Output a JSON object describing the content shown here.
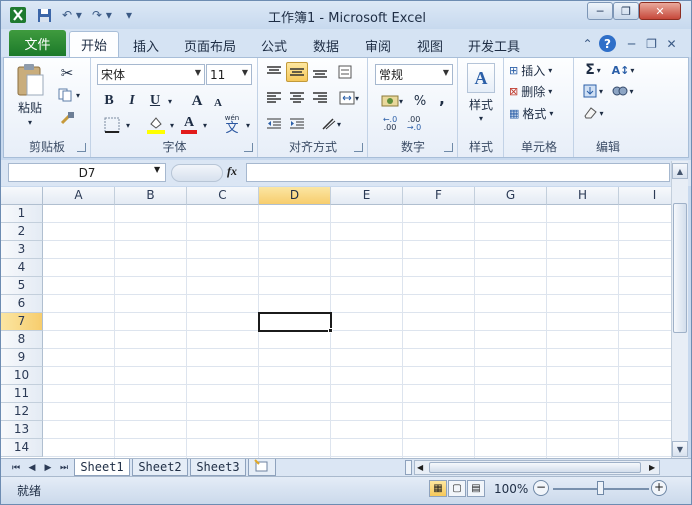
{
  "window": {
    "title": "工作簿1 - Microsoft Excel",
    "icons": {
      "app": "excel-icon",
      "save": "save-icon",
      "undo": "undo-icon",
      "redo": "redo-icon",
      "customize": "qat-customize-icon"
    },
    "controls": {
      "minimize": "─",
      "restore": "❐",
      "close": "✕"
    }
  },
  "tabs": {
    "file": "文件",
    "items": [
      "开始",
      "插入",
      "页面布局",
      "公式",
      "数据",
      "审阅",
      "视图",
      "开发工具"
    ],
    "active": "开始"
  },
  "ribbon": {
    "clipboard": {
      "label": "剪贴板",
      "paste": "粘贴"
    },
    "font": {
      "label": "字体",
      "name": "宋体",
      "size": "11",
      "bold": "B",
      "italic": "I",
      "underline": "U",
      "grow": "A",
      "shrink": "A",
      "phonetic": "wén",
      "phonetic_char": "文"
    },
    "alignment": {
      "label": "对齐方式"
    },
    "number": {
      "label": "数字",
      "format": "常规",
      "percent": "%",
      "comma": ",",
      "inc_decimal": ".00",
      "dec_decimal": ".00"
    },
    "styles": {
      "label": "样式",
      "button": "样式"
    },
    "cells": {
      "label": "单元格",
      "insert": "插入",
      "delete": "删除",
      "format": "格式"
    },
    "editing": {
      "label": "编辑",
      "sum": "Σ"
    }
  },
  "formula_bar": {
    "name_box": "D7",
    "fx": "fx",
    "value": ""
  },
  "grid": {
    "columns": [
      "A",
      "B",
      "C",
      "D",
      "E",
      "F",
      "G",
      "H",
      "I"
    ],
    "rows": [
      "1",
      "2",
      "3",
      "4",
      "5",
      "6",
      "7",
      "8",
      "9",
      "10",
      "11",
      "12",
      "13",
      "14"
    ],
    "selected_column": "D",
    "selected_row": "7"
  },
  "sheets": {
    "tabs": [
      "Sheet1",
      "Sheet2",
      "Sheet3"
    ],
    "active": "Sheet1"
  },
  "status": {
    "text": "就绪",
    "zoom": "100%"
  },
  "colors": {
    "excel_green": "#1c7a2a",
    "selection_orange": "#f7cd6d",
    "ribbon_blue": "#d5e3f3"
  }
}
